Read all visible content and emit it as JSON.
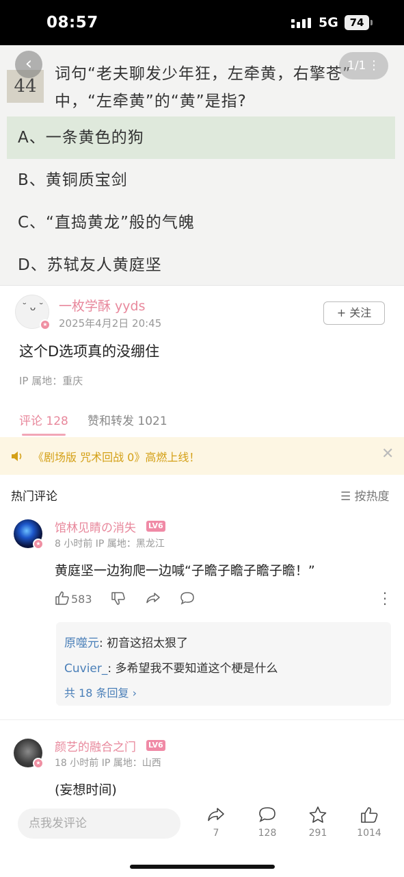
{
  "status_bar": {
    "time": "08:57",
    "network": "5G",
    "battery": "74"
  },
  "quiz": {
    "number": "44",
    "question_line1": "词句“老夫聊发少年狂，左牵黄，右擎苍”",
    "question_line2": "中，“左牵黄”的“黄”是指?",
    "page_indicator": "1/1",
    "options": [
      {
        "text": "A、一条黄色的狗",
        "selected": true
      },
      {
        "text": "B、黄铜质宝剑",
        "selected": false
      },
      {
        "text": "C、“直捣黄龙”般的气魄",
        "selected": false
      },
      {
        "text": "D、苏轼友人黄庭坚",
        "selected": false
      }
    ]
  },
  "post": {
    "author": "一枚学酥 yyds",
    "date": "2025年4月2日 20:45",
    "follow_label": "+ 关注",
    "text": "这个D选项真的没绷住",
    "ip": "IP 属地：重庆"
  },
  "tabs": {
    "comments": "评论 128",
    "likes": "赞和转发 1021"
  },
  "notice": {
    "text": "《剧场版 咒术回战 0》高燃上线！",
    "color": "#d4a017"
  },
  "comments_header": {
    "title": "热门评论",
    "sort": "按热度"
  },
  "comments": [
    {
      "author": "馆林见睛の消失",
      "level": "LV6",
      "meta": "8 小时前  IP 属地：黑龙江",
      "text": "黄庭坚一边狗爬一边喊“子瞻子瞻子瞻子瞻！”",
      "likes": "583",
      "replies": [
        {
          "name": "原噬元",
          "text": "初音这招太狠了"
        },
        {
          "name": "Cuvier_",
          "text": "多希望我不要知道这个梗是什么"
        }
      ],
      "reply_count": "共 18 条回复"
    },
    {
      "author": "颜艺的融合之门",
      "level": "LV6",
      "meta": "18 小时前  IP 属地：山西",
      "text": "(妄想时间)"
    }
  ],
  "bottom_bar": {
    "input_placeholder": "点我发评论",
    "share_count": "7",
    "comment_count": "128",
    "favorite_count": "291",
    "like_count": "1014"
  },
  "colors": {
    "accent_pink": "#e8889c",
    "link_blue": "#4a7fb8",
    "selected_option": "#dfe9dc"
  }
}
